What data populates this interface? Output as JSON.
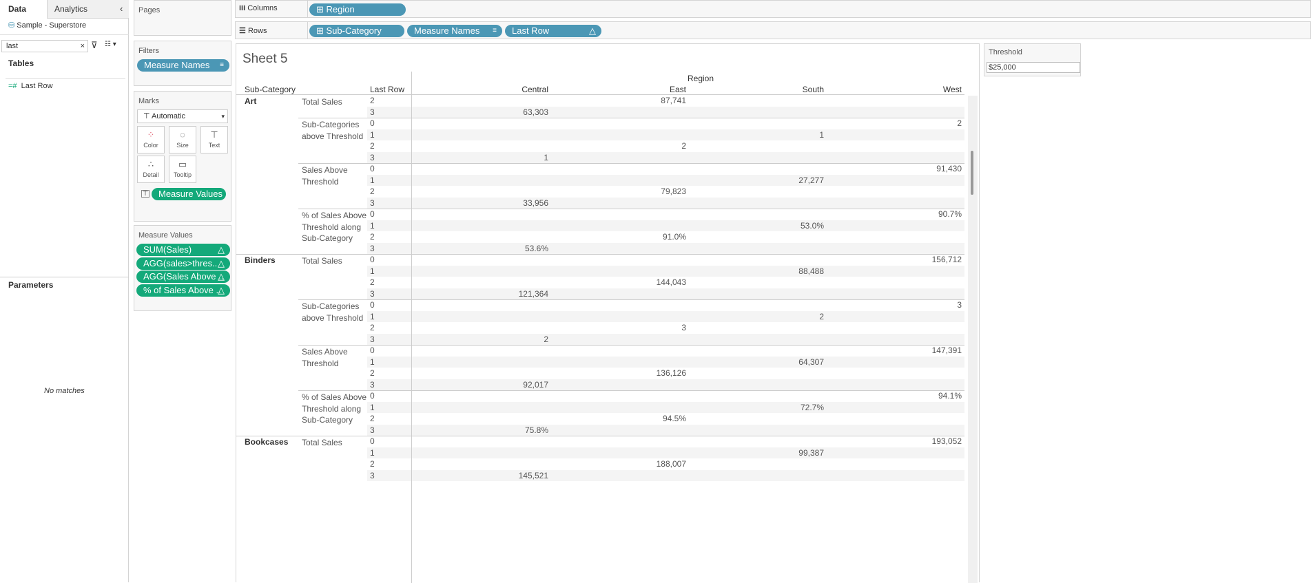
{
  "data_pane": {
    "tabs": [
      "Data",
      "Analytics"
    ],
    "datasource": "Sample - Superstore",
    "search_value": "last",
    "tables_heading": "Tables",
    "fields": [
      "Last Row"
    ],
    "parameters_heading": "Parameters",
    "no_matches": "No matches"
  },
  "shelves": {
    "pages": "Pages",
    "filters": "Filters",
    "filter_pills": [
      "Measure Names"
    ],
    "marks": "Marks",
    "mark_type": "Automatic",
    "mark_buttons": [
      "Color",
      "Size",
      "Text",
      "Detail",
      "Tooltip"
    ],
    "marks_pill": "Measure Values",
    "measure_values_heading": "Measure Values",
    "measure_values": [
      "SUM(Sales)",
      "AGG(sales>thres..",
      "AGG(Sales Above ..",
      "% of Sales Above .."
    ],
    "columns_label": "Columns",
    "rows_label": "Rows",
    "column_pills": [
      "Region"
    ],
    "row_pills": [
      "Sub-Category",
      "Measure Names",
      "Last Row"
    ]
  },
  "sheet": {
    "title": "Sheet 5",
    "region_header": "Region",
    "headers": [
      "Sub-Category",
      "Last Row"
    ],
    "regions": [
      "Central",
      "East",
      "South",
      "West"
    ],
    "subcategories": [
      {
        "name": "Art",
        "measures": [
          {
            "name": "Total Sales",
            "rows": [
              {
                "last_row": "2",
                "region": "East",
                "value": "87,741"
              },
              {
                "last_row": "3",
                "region": "Central",
                "value": "63,303"
              }
            ]
          },
          {
            "name": "Sub-Categories above Threshold",
            "rows": [
              {
                "last_row": "0",
                "region": "West",
                "value": "2"
              },
              {
                "last_row": "1",
                "region": "South",
                "value": "1"
              },
              {
                "last_row": "2",
                "region": "East",
                "value": "2"
              },
              {
                "last_row": "3",
                "region": "Central",
                "value": "1"
              }
            ]
          },
          {
            "name": "Sales Above Threshold",
            "rows": [
              {
                "last_row": "0",
                "region": "West",
                "value": "91,430"
              },
              {
                "last_row": "1",
                "region": "South",
                "value": "27,277"
              },
              {
                "last_row": "2",
                "region": "East",
                "value": "79,823"
              },
              {
                "last_row": "3",
                "region": "Central",
                "value": "33,956"
              }
            ]
          },
          {
            "name": "% of Sales Above Threshold along Sub-Category",
            "rows": [
              {
                "last_row": "0",
                "region": "West",
                "value": "90.7%"
              },
              {
                "last_row": "1",
                "region": "South",
                "value": "53.0%"
              },
              {
                "last_row": "2",
                "region": "East",
                "value": "91.0%"
              },
              {
                "last_row": "3",
                "region": "Central",
                "value": "53.6%"
              }
            ]
          }
        ]
      },
      {
        "name": "Binders",
        "measures": [
          {
            "name": "Total Sales",
            "rows": [
              {
                "last_row": "0",
                "region": "West",
                "value": "156,712"
              },
              {
                "last_row": "1",
                "region": "South",
                "value": "88,488"
              },
              {
                "last_row": "2",
                "region": "East",
                "value": "144,043"
              },
              {
                "last_row": "3",
                "region": "Central",
                "value": "121,364"
              }
            ]
          },
          {
            "name": "Sub-Categories above Threshold",
            "rows": [
              {
                "last_row": "0",
                "region": "West",
                "value": "3"
              },
              {
                "last_row": "1",
                "region": "South",
                "value": "2"
              },
              {
                "last_row": "2",
                "region": "East",
                "value": "3"
              },
              {
                "last_row": "3",
                "region": "Central",
                "value": "2"
              }
            ]
          },
          {
            "name": "Sales Above Threshold",
            "rows": [
              {
                "last_row": "0",
                "region": "West",
                "value": "147,391"
              },
              {
                "last_row": "1",
                "region": "South",
                "value": "64,307"
              },
              {
                "last_row": "2",
                "region": "East",
                "value": "136,126"
              },
              {
                "last_row": "3",
                "region": "Central",
                "value": "92,017"
              }
            ]
          },
          {
            "name": "% of Sales Above Threshold along Sub-Category",
            "rows": [
              {
                "last_row": "0",
                "region": "West",
                "value": "94.1%"
              },
              {
                "last_row": "1",
                "region": "South",
                "value": "72.7%"
              },
              {
                "last_row": "2",
                "region": "East",
                "value": "94.5%"
              },
              {
                "last_row": "3",
                "region": "Central",
                "value": "75.8%"
              }
            ]
          }
        ]
      },
      {
        "name": "Bookcases",
        "measures": [
          {
            "name": "Total Sales",
            "rows": [
              {
                "last_row": "0",
                "region": "West",
                "value": "193,052"
              },
              {
                "last_row": "1",
                "region": "South",
                "value": "99,387"
              },
              {
                "last_row": "2",
                "region": "East",
                "value": "188,007"
              },
              {
                "last_row": "3",
                "region": "Central",
                "value": "145,521"
              }
            ]
          }
        ]
      }
    ]
  },
  "threshold": {
    "title": "Threshold",
    "value": "$25,000"
  }
}
